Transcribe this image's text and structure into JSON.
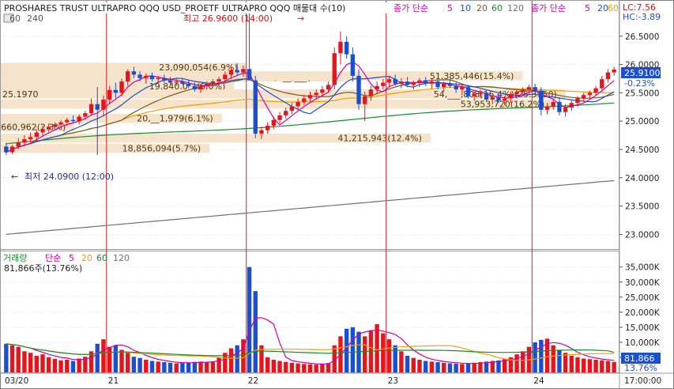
{
  "header": {
    "title": "PROSHARES TRUST ULTRAPRO QQQ USD_PROETF ULTRAPRO QQQ 매물대 수(10)",
    "ma_label": "종가 단순",
    "ma_periods": [
      "5",
      "10",
      "20",
      "60",
      "120"
    ],
    "ma_label_right": "종가 단순",
    "ma_periods_right": [
      "5",
      "20",
      "60"
    ],
    "lc_text": "LC:7.56",
    "hc_text": "HC:-3.89",
    "interval_left": "60",
    "interval_right": "240"
  },
  "annotations": {
    "high_label": "최고 26.9600 (14:00)",
    "low_label": "최저 24.0900 (12:00)",
    "last_price_label": "25.9100",
    "change_label": "-0.23%",
    "volume_header": "거래량",
    "volume_ma_label": "단순",
    "volume_ma_periods": [
      "5",
      "20",
      "60",
      "120"
    ],
    "volume_value_label": "81,866주(13.76%)",
    "volume_last_label": "81,866",
    "volume_pct_label": "13.76%"
  },
  "colors": {
    "up": "#e8141c",
    "down": "#1b4fd1",
    "ma5": "#d000a8",
    "ma10": "#1b4fd1",
    "ma20": "#7a5a1a",
    "ma60": "#f0a000",
    "ma120": "#1a8a2a",
    "ma240": "#707070",
    "profile": "#f5e3cc",
    "session_line": "#cc2020"
  },
  "chart_data": {
    "type": "candlestick",
    "price_axis": {
      "min": 23.0,
      "max": 26.5,
      "ticks": [
        "23.0000",
        "23.5000",
        "24.0000",
        "24.5000",
        "25.0000",
        "25.5000",
        "26.0000",
        "26.5000"
      ]
    },
    "volume_axis": {
      "min": 0,
      "max": 35000,
      "ticks": [
        "5,000K",
        "10,000K",
        "15,000K",
        "20,000K",
        "25,000K",
        "30,000K",
        "35,000K"
      ]
    },
    "x_labels": [
      {
        "label": "03/20",
        "index": 0
      },
      {
        "label": "21",
        "index": 17
      },
      {
        "label": "22",
        "index": 40
      },
      {
        "label": "23",
        "index": 63
      },
      {
        "label": "24",
        "index": 87
      },
      {
        "label": "17:00:00",
        "index": 101
      }
    ],
    "candles": [
      [
        24.55,
        24.62,
        24.4,
        24.45
      ],
      [
        24.45,
        24.58,
        24.42,
        24.55
      ],
      [
        24.55,
        24.7,
        24.5,
        24.62
      ],
      [
        24.62,
        24.75,
        24.55,
        24.68
      ],
      [
        24.68,
        24.8,
        24.6,
        24.72
      ],
      [
        24.72,
        24.85,
        24.66,
        24.8
      ],
      [
        24.8,
        24.92,
        24.74,
        24.86
      ],
      [
        24.86,
        24.96,
        24.8,
        24.9
      ],
      [
        24.9,
        24.98,
        24.84,
        24.94
      ],
      [
        24.94,
        25.02,
        24.88,
        24.98
      ],
      [
        24.98,
        25.06,
        24.92,
        25.02
      ],
      [
        25.02,
        25.1,
        24.96,
        25.0
      ],
      [
        25.0,
        25.12,
        24.94,
        25.08
      ],
      [
        25.08,
        25.18,
        25.02,
        25.14
      ],
      [
        25.14,
        25.4,
        25.1,
        25.3
      ],
      [
        25.3,
        25.6,
        24.4,
        25.2
      ],
      [
        25.2,
        25.45,
        25.1,
        25.38
      ],
      [
        25.38,
        25.62,
        25.3,
        25.55
      ],
      [
        25.55,
        25.68,
        25.4,
        25.5
      ],
      [
        25.5,
        25.75,
        25.44,
        25.7
      ],
      [
        25.7,
        25.92,
        25.62,
        25.88
      ],
      [
        25.88,
        25.96,
        25.76,
        25.82
      ],
      [
        25.82,
        25.88,
        25.7,
        25.76
      ],
      [
        25.76,
        25.84,
        25.66,
        25.8
      ],
      [
        25.8,
        25.86,
        25.7,
        25.74
      ],
      [
        25.74,
        25.8,
        25.66,
        25.76
      ],
      [
        25.76,
        25.82,
        25.68,
        25.72
      ],
      [
        25.72,
        25.78,
        25.64,
        25.68
      ],
      [
        25.68,
        25.74,
        25.62,
        25.7
      ],
      [
        25.7,
        25.76,
        25.64,
        25.66
      ],
      [
        25.66,
        25.72,
        25.58,
        25.62
      ],
      [
        25.62,
        25.68,
        25.52,
        25.56
      ],
      [
        25.56,
        25.66,
        25.5,
        25.62
      ],
      [
        25.62,
        25.7,
        25.56,
        25.66
      ],
      [
        25.66,
        25.74,
        25.6,
        25.7
      ],
      [
        25.7,
        25.78,
        25.62,
        25.74
      ],
      [
        25.74,
        25.88,
        25.66,
        25.82
      ],
      [
        25.82,
        25.96,
        25.74,
        25.9
      ],
      [
        25.9,
        26.02,
        25.8,
        25.86
      ],
      [
        25.86,
        25.98,
        25.78,
        25.92
      ],
      [
        25.92,
        26.96,
        25.8,
        25.72
      ],
      [
        25.72,
        25.8,
        24.7,
        24.78
      ],
      [
        24.78,
        24.9,
        24.68,
        24.84
      ],
      [
        24.84,
        24.98,
        24.78,
        24.92
      ],
      [
        24.92,
        25.08,
        24.86,
        25.02
      ],
      [
        25.02,
        25.16,
        24.96,
        25.1
      ],
      [
        25.1,
        25.24,
        25.04,
        25.18
      ],
      [
        25.18,
        25.32,
        25.12,
        25.26
      ],
      [
        25.26,
        25.4,
        25.2,
        25.34
      ],
      [
        25.34,
        25.46,
        25.28,
        25.4
      ],
      [
        25.4,
        25.52,
        25.34,
        25.46
      ],
      [
        25.46,
        25.56,
        25.38,
        25.5
      ],
      [
        25.5,
        25.62,
        25.44,
        25.56
      ],
      [
        25.56,
        25.7,
        25.5,
        25.64
      ],
      [
        25.64,
        26.3,
        25.56,
        26.2
      ],
      [
        26.2,
        26.58,
        26.0,
        26.4
      ],
      [
        26.4,
        26.5,
        26.1,
        26.18
      ],
      [
        26.18,
        26.3,
        25.7,
        25.8
      ],
      [
        25.8,
        25.92,
        25.2,
        25.3
      ],
      [
        25.3,
        25.52,
        25.0,
        25.44
      ],
      [
        25.44,
        25.62,
        25.36,
        25.56
      ],
      [
        25.56,
        25.7,
        25.48,
        25.62
      ],
      [
        25.62,
        25.74,
        25.56,
        25.68
      ],
      [
        25.68,
        25.8,
        25.6,
        25.74
      ],
      [
        25.74,
        25.82,
        25.62,
        25.66
      ],
      [
        25.66,
        25.76,
        25.58,
        25.7
      ],
      [
        25.7,
        25.78,
        25.6,
        25.64
      ],
      [
        25.64,
        25.72,
        25.56,
        25.68
      ],
      [
        25.68,
        25.76,
        25.6,
        25.72
      ],
      [
        25.72,
        25.78,
        25.62,
        25.66
      ],
      [
        25.66,
        25.76,
        25.58,
        25.7
      ],
      [
        25.7,
        25.74,
        25.56,
        25.6
      ],
      [
        25.6,
        25.7,
        25.52,
        25.66
      ],
      [
        25.66,
        25.74,
        25.58,
        25.62
      ],
      [
        25.62,
        25.68,
        25.5,
        25.56
      ],
      [
        25.56,
        25.66,
        25.46,
        25.6
      ],
      [
        25.6,
        25.64,
        25.4,
        25.44
      ],
      [
        25.44,
        25.52,
        25.36,
        25.48
      ],
      [
        25.48,
        25.56,
        25.4,
        25.5
      ],
      [
        25.5,
        25.54,
        25.34,
        25.38
      ],
      [
        25.38,
        25.46,
        25.3,
        25.42
      ],
      [
        25.42,
        25.48,
        25.32,
        25.36
      ],
      [
        25.36,
        25.44,
        25.28,
        25.4
      ],
      [
        25.4,
        25.52,
        25.32,
        25.48
      ],
      [
        25.48,
        25.56,
        25.4,
        25.52
      ],
      [
        25.52,
        25.6,
        25.44,
        25.56
      ],
      [
        25.56,
        25.64,
        25.48,
        25.6
      ],
      [
        25.6,
        25.66,
        25.5,
        25.54
      ],
      [
        25.54,
        25.6,
        25.1,
        25.2
      ],
      [
        25.2,
        25.32,
        25.12,
        25.26
      ],
      [
        25.26,
        25.4,
        25.2,
        25.34
      ],
      [
        25.34,
        25.42,
        25.1,
        25.16
      ],
      [
        25.16,
        25.3,
        25.08,
        25.24
      ],
      [
        25.24,
        25.36,
        25.18,
        25.32
      ],
      [
        25.32,
        25.44,
        25.26,
        25.4
      ],
      [
        25.4,
        25.5,
        25.34,
        25.46
      ],
      [
        25.46,
        25.54,
        25.4,
        25.5
      ],
      [
        25.5,
        25.62,
        25.44,
        25.58
      ],
      [
        25.58,
        25.8,
        25.52,
        25.74
      ],
      [
        25.74,
        25.92,
        25.68,
        25.86
      ],
      [
        25.86,
        25.96,
        25.8,
        25.91
      ]
    ],
    "volumes": [
      9500,
      9000,
      8500,
      7000,
      6500,
      5500,
      6000,
      5000,
      4500,
      4000,
      4200,
      3800,
      4600,
      5200,
      7000,
      9500,
      11000,
      8500,
      9000,
      7500,
      6500,
      5200,
      4800,
      4200,
      3800,
      3600,
      3400,
      3200,
      3000,
      3100,
      3300,
      3500,
      3600,
      3400,
      3700,
      5000,
      6500,
      8000,
      9000,
      11000,
      35000,
      27000,
      9000,
      5000,
      4200,
      3800,
      3500,
      3200,
      3000,
      2800,
      2700,
      2600,
      2900,
      3100,
      9000,
      12000,
      14500,
      15000,
      13500,
      12000,
      14000,
      16000,
      13000,
      11000,
      9000,
      7000,
      5500,
      4800,
      4200,
      3800,
      3600,
      3400,
      3200,
      3000,
      2900,
      2800,
      3000,
      3200,
      3400,
      3600,
      3800,
      4000,
      4400,
      5000,
      6000,
      7000,
      8500,
      10000,
      10800,
      11200,
      9000,
      7500,
      6500,
      5500,
      5000,
      4600,
      4400,
      4200,
      4000,
      3800,
      3500
    ],
    "volume_profile": [
      {
        "label": "23,090,054(6.9%)",
        "price": 25.95,
        "width": 0.4
      },
      {
        "label": "32,3__,___(9.7%)",
        "price": 25.78,
        "width": 0.56
      },
      {
        "label": "51,385,446(15.4%)",
        "price": 25.8,
        "width": 0.85
      },
      {
        "label": "19,840,0__(6.0%)",
        "price": 25.62,
        "width": 0.38
      },
      {
        "label": "54,___,808(16.4%)(25.3950)",
        "price": 25.48,
        "width": 0.92
      },
      {
        "label": "25.1970",
        "price": 25.48,
        "width": 0.0
      },
      {
        "label": "53,953,720(16.2%)",
        "price": 25.3,
        "width": 0.9
      },
      {
        "label": "20,__1,979(6.1%)",
        "price": 25.05,
        "width": 0.36
      },
      {
        "label": "7,660,962(2.3%)",
        "price": 24.9,
        "width": 0.12
      },
      {
        "label": "41,215,943(12.4%)",
        "price": 24.7,
        "width": 0.7
      },
      {
        "label": "18,856,094(5.7%)",
        "price": 24.52,
        "width": 0.34
      }
    ]
  }
}
